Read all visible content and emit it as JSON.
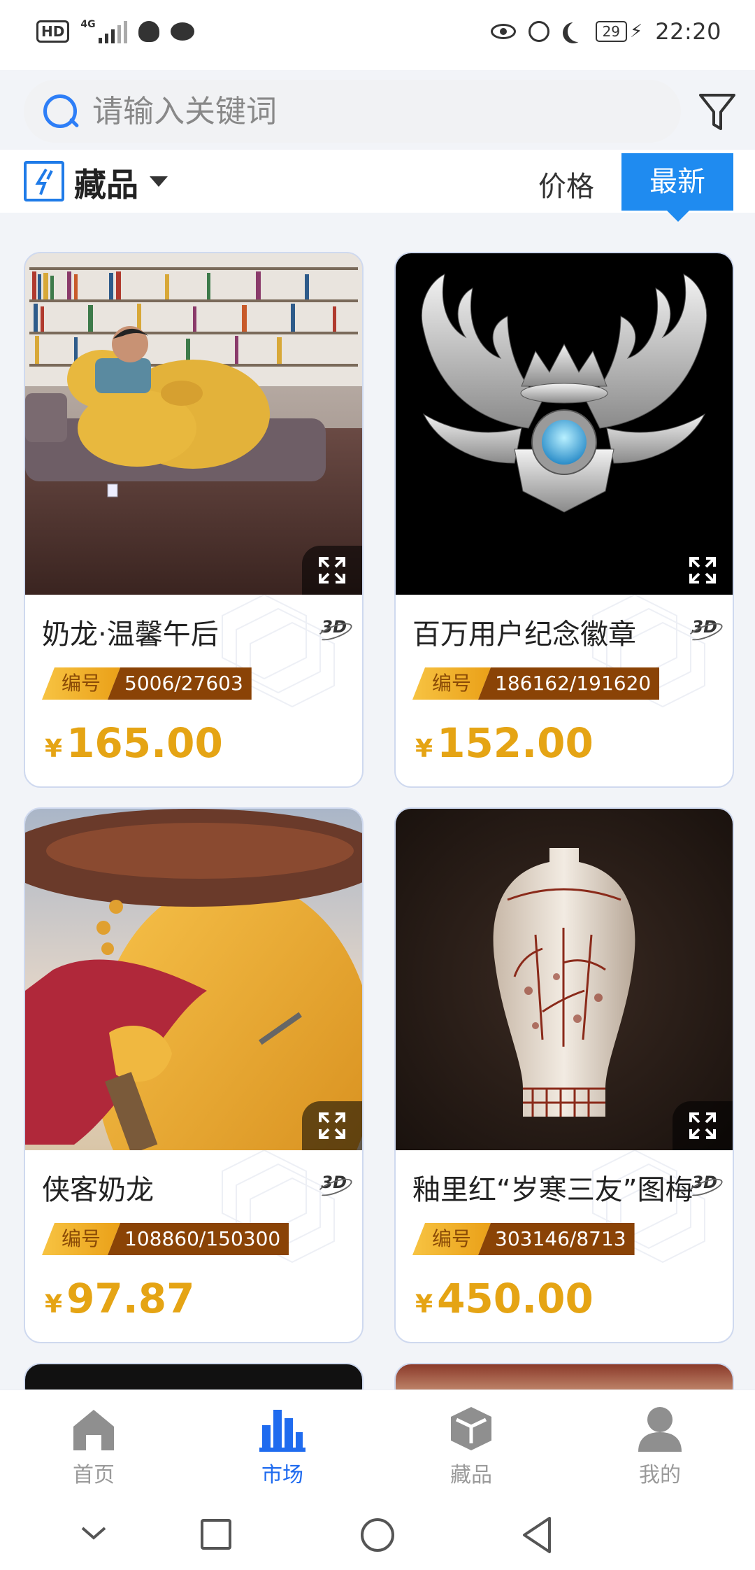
{
  "status_bar": {
    "hd_label": "HD",
    "network": "4G",
    "battery": "29",
    "time": "22:20"
  },
  "search": {
    "placeholder": "请输入关键词",
    "value": ""
  },
  "category": {
    "label": "藏品"
  },
  "sort": {
    "price_label": "价格",
    "newest_label": "最新",
    "active": "newest"
  },
  "accent_color": "#1f8bf0",
  "price_color": "#e5a414",
  "cards": [
    {
      "title": "奶龙·温馨午后",
      "serial_label": "编号",
      "serial": "5006/27603",
      "currency": "¥",
      "price": "165.00",
      "badge": "3D",
      "image": "dragon-sleeping-on-sofa"
    },
    {
      "title": "百万用户纪念徽章",
      "serial_label": "编号",
      "serial": "186162/191620",
      "currency": "¥",
      "price": "152.00",
      "badge": "3D",
      "image": "winged-silver-badge"
    },
    {
      "title": "侠客奶龙",
      "serial_label": "编号",
      "serial": "108860/150300",
      "currency": "¥",
      "price": "97.87",
      "badge": "3D",
      "image": "dragon-swordsman"
    },
    {
      "title": "釉里红“岁寒三友”图梅",
      "serial_label": "编号",
      "serial": "303146/8713",
      "currency": "¥",
      "price": "450.00",
      "badge": "3D",
      "image": "porcelain-vase"
    }
  ],
  "bottom_nav": [
    {
      "label": "首页",
      "icon": "home-icon",
      "active": false
    },
    {
      "label": "市场",
      "icon": "market-chart-icon",
      "active": true
    },
    {
      "label": "藏品",
      "icon": "collection-box-icon",
      "active": false
    },
    {
      "label": "我的",
      "icon": "profile-icon",
      "active": false
    }
  ]
}
